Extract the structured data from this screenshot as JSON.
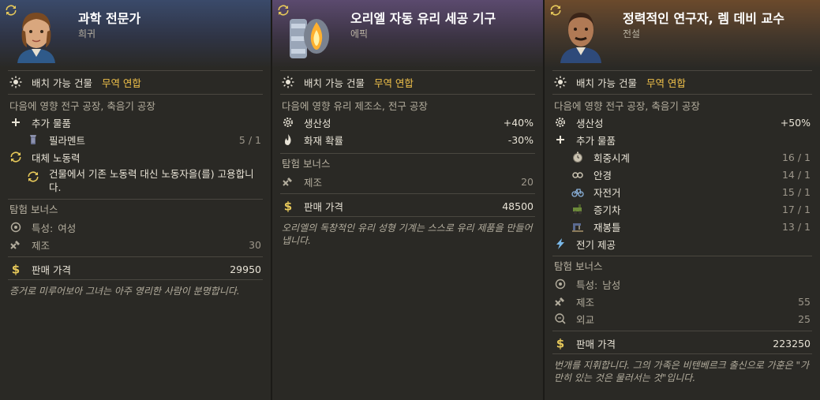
{
  "cards": [
    {
      "name": "과학 전문가",
      "rarity": "희귀",
      "placeable_label": "배치 가능 건물",
      "placeable_value": "무역 연합",
      "affects": "다음에 영향 전구 공장, 축음기 공장",
      "extra_goods_label": "추가 물품",
      "extra_goods": [
        {
          "name": "필라멘트",
          "value": "5 / 1"
        }
      ],
      "replace_label": "대체 노동력",
      "replace_desc": "건물에서 기존 노동력 대신 노동자을(를) 고용합니다.",
      "expedition_title": "탐험 보너스",
      "trait_label": "특성:",
      "trait_value": "여성",
      "craft_label": "제조",
      "craft_value": "30",
      "price_label": "판매 가격",
      "price_value": "29950",
      "flavor": "증거로 미루어보아 그녀는 아주 영리한 사람이 분명합니다."
    },
    {
      "name": "오리엘 자동 유리 세공 기구",
      "rarity": "에픽",
      "placeable_label": "배치 가능 건물",
      "placeable_value": "무역 연합",
      "affects": "다음에 영향 유리 제조소, 전구 공장",
      "productivity_label": "생산성",
      "productivity_value": "+40%",
      "fire_label": "화재 확률",
      "fire_value": "-30%",
      "expedition_title": "탐험 보너스",
      "craft_label": "제조",
      "craft_value": "20",
      "price_label": "판매 가격",
      "price_value": "48500",
      "flavor": "오리엘의 독창적인 유리 성형 기계는 스스로 유리 제품을 만들어 냅니다."
    },
    {
      "name": "정력적인 연구자, 렘 데비 교수",
      "rarity": "전설",
      "placeable_label": "배치 가능 건물",
      "placeable_value": "무역 연합",
      "affects": "다음에 영향 전구 공장, 축음기 공장",
      "productivity_label": "생산성",
      "productivity_value": "+50%",
      "extra_goods_label": "추가 물품",
      "extra_goods": [
        {
          "name": "회중시계",
          "value": "16 / 1"
        },
        {
          "name": "안경",
          "value": "14 / 1"
        },
        {
          "name": "자전거",
          "value": "15 / 1"
        },
        {
          "name": "증기차",
          "value": "17 / 1"
        },
        {
          "name": "재봉틀",
          "value": "13 / 1"
        }
      ],
      "electricity_label": "전기 제공",
      "expedition_title": "탐험 보너스",
      "trait_label": "특성:",
      "trait_value": "남성",
      "craft_label": "제조",
      "craft_value": "55",
      "diplomacy_label": "외교",
      "diplomacy_value": "25",
      "price_label": "판매 가격",
      "price_value": "223250",
      "flavor": "번개를 지휘합니다. 그의 가족은 비텐베르크 출신으로 가훈은 \"가만히 있는 것은 물러서는 것\"입니다."
    }
  ]
}
